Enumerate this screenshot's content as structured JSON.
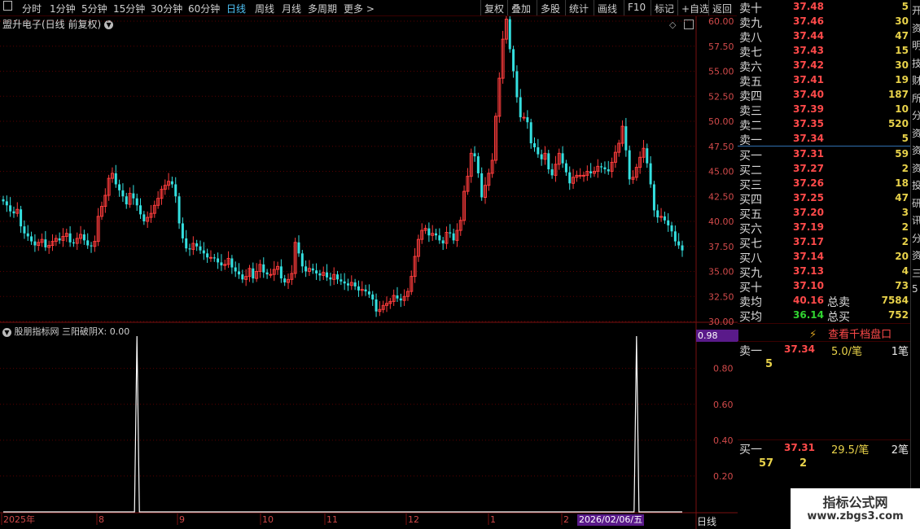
{
  "toolbar": {
    "left": [
      "分时",
      "1分钟",
      "5分钟",
      "15分钟",
      "30分钟",
      "60分钟",
      "日线",
      "周线",
      "月线",
      "多周期",
      "更多 >"
    ],
    "active_index": 6,
    "right": [
      "复权",
      "叠加",
      "多股",
      "统计",
      "画线",
      "F10",
      "标记",
      "+自选",
      "返回"
    ]
  },
  "chart": {
    "title": "盟升电子(日线 前复权)",
    "price_ticks": [
      "60.00",
      "57.50",
      "55.00",
      "52.50",
      "50.00",
      "47.50",
      "45.00",
      "42.50",
      "40.00",
      "37.50",
      "35.00",
      "32.50",
      "30.00"
    ],
    "ylim": [
      30,
      60
    ],
    "x_labels": [
      "2025年",
      "8",
      "9",
      "10",
      "11",
      "12",
      "1",
      "2"
    ],
    "date_tag": "2026/02/06/五",
    "period": "日线",
    "up_color": "#ff3c3c",
    "down_color": "#34e0e0"
  },
  "chart_data": {
    "type": "candlestick",
    "close": [
      42,
      41.6,
      41,
      40.8,
      41.2,
      39.5,
      38.8,
      38.5,
      38,
      37.6,
      37.9,
      38.2,
      37.4,
      37.6,
      38,
      38.3,
      38.1,
      38.5,
      38.8,
      37.9,
      37.8,
      38.3,
      38.7,
      38.1,
      37.6,
      37.5,
      38,
      40.5,
      41.5,
      42.6,
      44.3,
      44.8,
      43.7,
      43.1,
      42.5,
      41.7,
      42.8,
      42.3,
      41.6,
      40.7,
      40,
      40.4,
      40.8,
      41.6,
      42.3,
      43.2,
      43.6,
      44,
      43.7,
      42.5,
      39.8,
      38.3,
      37.3,
      37.2,
      37.8,
      37.5,
      37.1,
      36.8,
      36.4,
      36.4,
      36.3,
      35.9,
      35.6,
      35.7,
      36.3,
      35.4,
      35,
      34.7,
      34.2,
      34.5,
      35.3,
      34.3,
      35,
      35.7,
      34.9,
      34.7,
      34.7,
      35.2,
      35.5,
      34.3,
      33.9,
      34.2,
      34.8,
      37.9,
      36.8,
      35.5,
      35,
      35.3,
      35.1,
      34.8,
      34.6,
      34.9,
      34.4,
      34.2,
      34.7,
      34.2,
      34,
      33.8,
      33.6,
      33.9,
      33.5,
      33.1,
      33.2,
      33,
      32.7,
      32.2,
      31,
      31.2,
      31.6,
      31.8,
      32,
      32.6,
      32.3,
      32.1,
      32.5,
      33,
      34.5,
      36.5,
      38.2,
      39.1,
      39.3,
      38.6,
      38.8,
      38.6,
      38.1,
      37.8,
      38.9,
      38.8,
      38.1,
      39.1,
      40.1,
      43,
      44.5,
      46.8,
      46.5,
      44.8,
      42.4,
      43.6,
      44.8,
      46.1,
      50.5,
      54.3,
      58.2,
      60.2,
      57.2,
      55,
      52.4,
      50.4,
      50.4,
      49.9,
      47.8,
      47.4,
      46.7,
      46.2,
      46.8,
      45.2,
      44.6,
      45.7,
      46.8,
      45.8,
      44.9,
      43.8,
      44.4,
      44.6,
      44.6,
      44.6,
      45,
      44.8,
      45,
      45.5,
      45.4,
      45.2,
      45,
      45.9,
      46.9,
      47.8,
      49.5,
      47.1,
      44.2,
      44.4,
      45.4,
      46.4,
      47.3,
      45.8,
      43.7,
      41.1,
      40.4,
      40.5,
      40.1,
      39.6,
      39,
      38,
      37.6,
      37.1
    ],
    "indicator": {
      "name": "股朋指标网 三阳破阴X: 0.00",
      "max_label": "0.98",
      "ticks": [
        "0.80",
        "0.60",
        "0.40",
        "0.20"
      ],
      "spikes_at": [
        38,
        180
      ]
    }
  },
  "order_book": {
    "asks": [
      {
        "label": "卖十",
        "price": "37.48",
        "vol": "5"
      },
      {
        "label": "卖九",
        "price": "37.46",
        "vol": "30"
      },
      {
        "label": "卖八",
        "price": "37.44",
        "vol": "47"
      },
      {
        "label": "卖七",
        "price": "37.43",
        "vol": "15"
      },
      {
        "label": "卖六",
        "price": "37.42",
        "vol": "30"
      },
      {
        "label": "卖五",
        "price": "37.41",
        "vol": "19"
      },
      {
        "label": "卖四",
        "price": "37.40",
        "vol": "187"
      },
      {
        "label": "卖三",
        "price": "37.39",
        "vol": "10"
      },
      {
        "label": "卖二",
        "price": "37.35",
        "vol": "520"
      },
      {
        "label": "卖一",
        "price": "37.34",
        "vol": "5"
      }
    ],
    "bids": [
      {
        "label": "买一",
        "price": "37.31",
        "vol": "59"
      },
      {
        "label": "买二",
        "price": "37.27",
        "vol": "2"
      },
      {
        "label": "买三",
        "price": "37.26",
        "vol": "18"
      },
      {
        "label": "买四",
        "price": "37.25",
        "vol": "47"
      },
      {
        "label": "买五",
        "price": "37.20",
        "vol": "3"
      },
      {
        "label": "买六",
        "price": "37.19",
        "vol": "2"
      },
      {
        "label": "买七",
        "price": "37.17",
        "vol": "2"
      },
      {
        "label": "买八",
        "price": "37.14",
        "vol": "20"
      },
      {
        "label": "买九",
        "price": "37.13",
        "vol": "4"
      },
      {
        "label": "买十",
        "price": "37.10",
        "vol": "73"
      }
    ],
    "avg_sell": {
      "label": "卖均",
      "price": "40.16",
      "total_label": "总卖",
      "total": "7584"
    },
    "avg_buy": {
      "label": "买均",
      "price": "36.14",
      "total_label": "总买",
      "total": "752"
    },
    "depth_link": "查看千档盘口",
    "sell1": {
      "label": "卖一",
      "price": "37.34",
      "per": "5.0/笔",
      "count": "1笔",
      "queue": "5"
    },
    "buy1": {
      "label": "买一",
      "price": "37.31",
      "per": "29.5/笔",
      "count": "2笔",
      "queue1": "57",
      "queue2": "2"
    }
  },
  "right_strip": [
    "开",
    "资",
    "明",
    "技",
    "财",
    "所",
    "分",
    "资",
    "资",
    "资",
    "投",
    "研",
    "讯",
    "分",
    "资",
    "三",
    "5"
  ],
  "watermark": {
    "line1": "指标公式网",
    "line2": "www.zbgs3.com"
  }
}
